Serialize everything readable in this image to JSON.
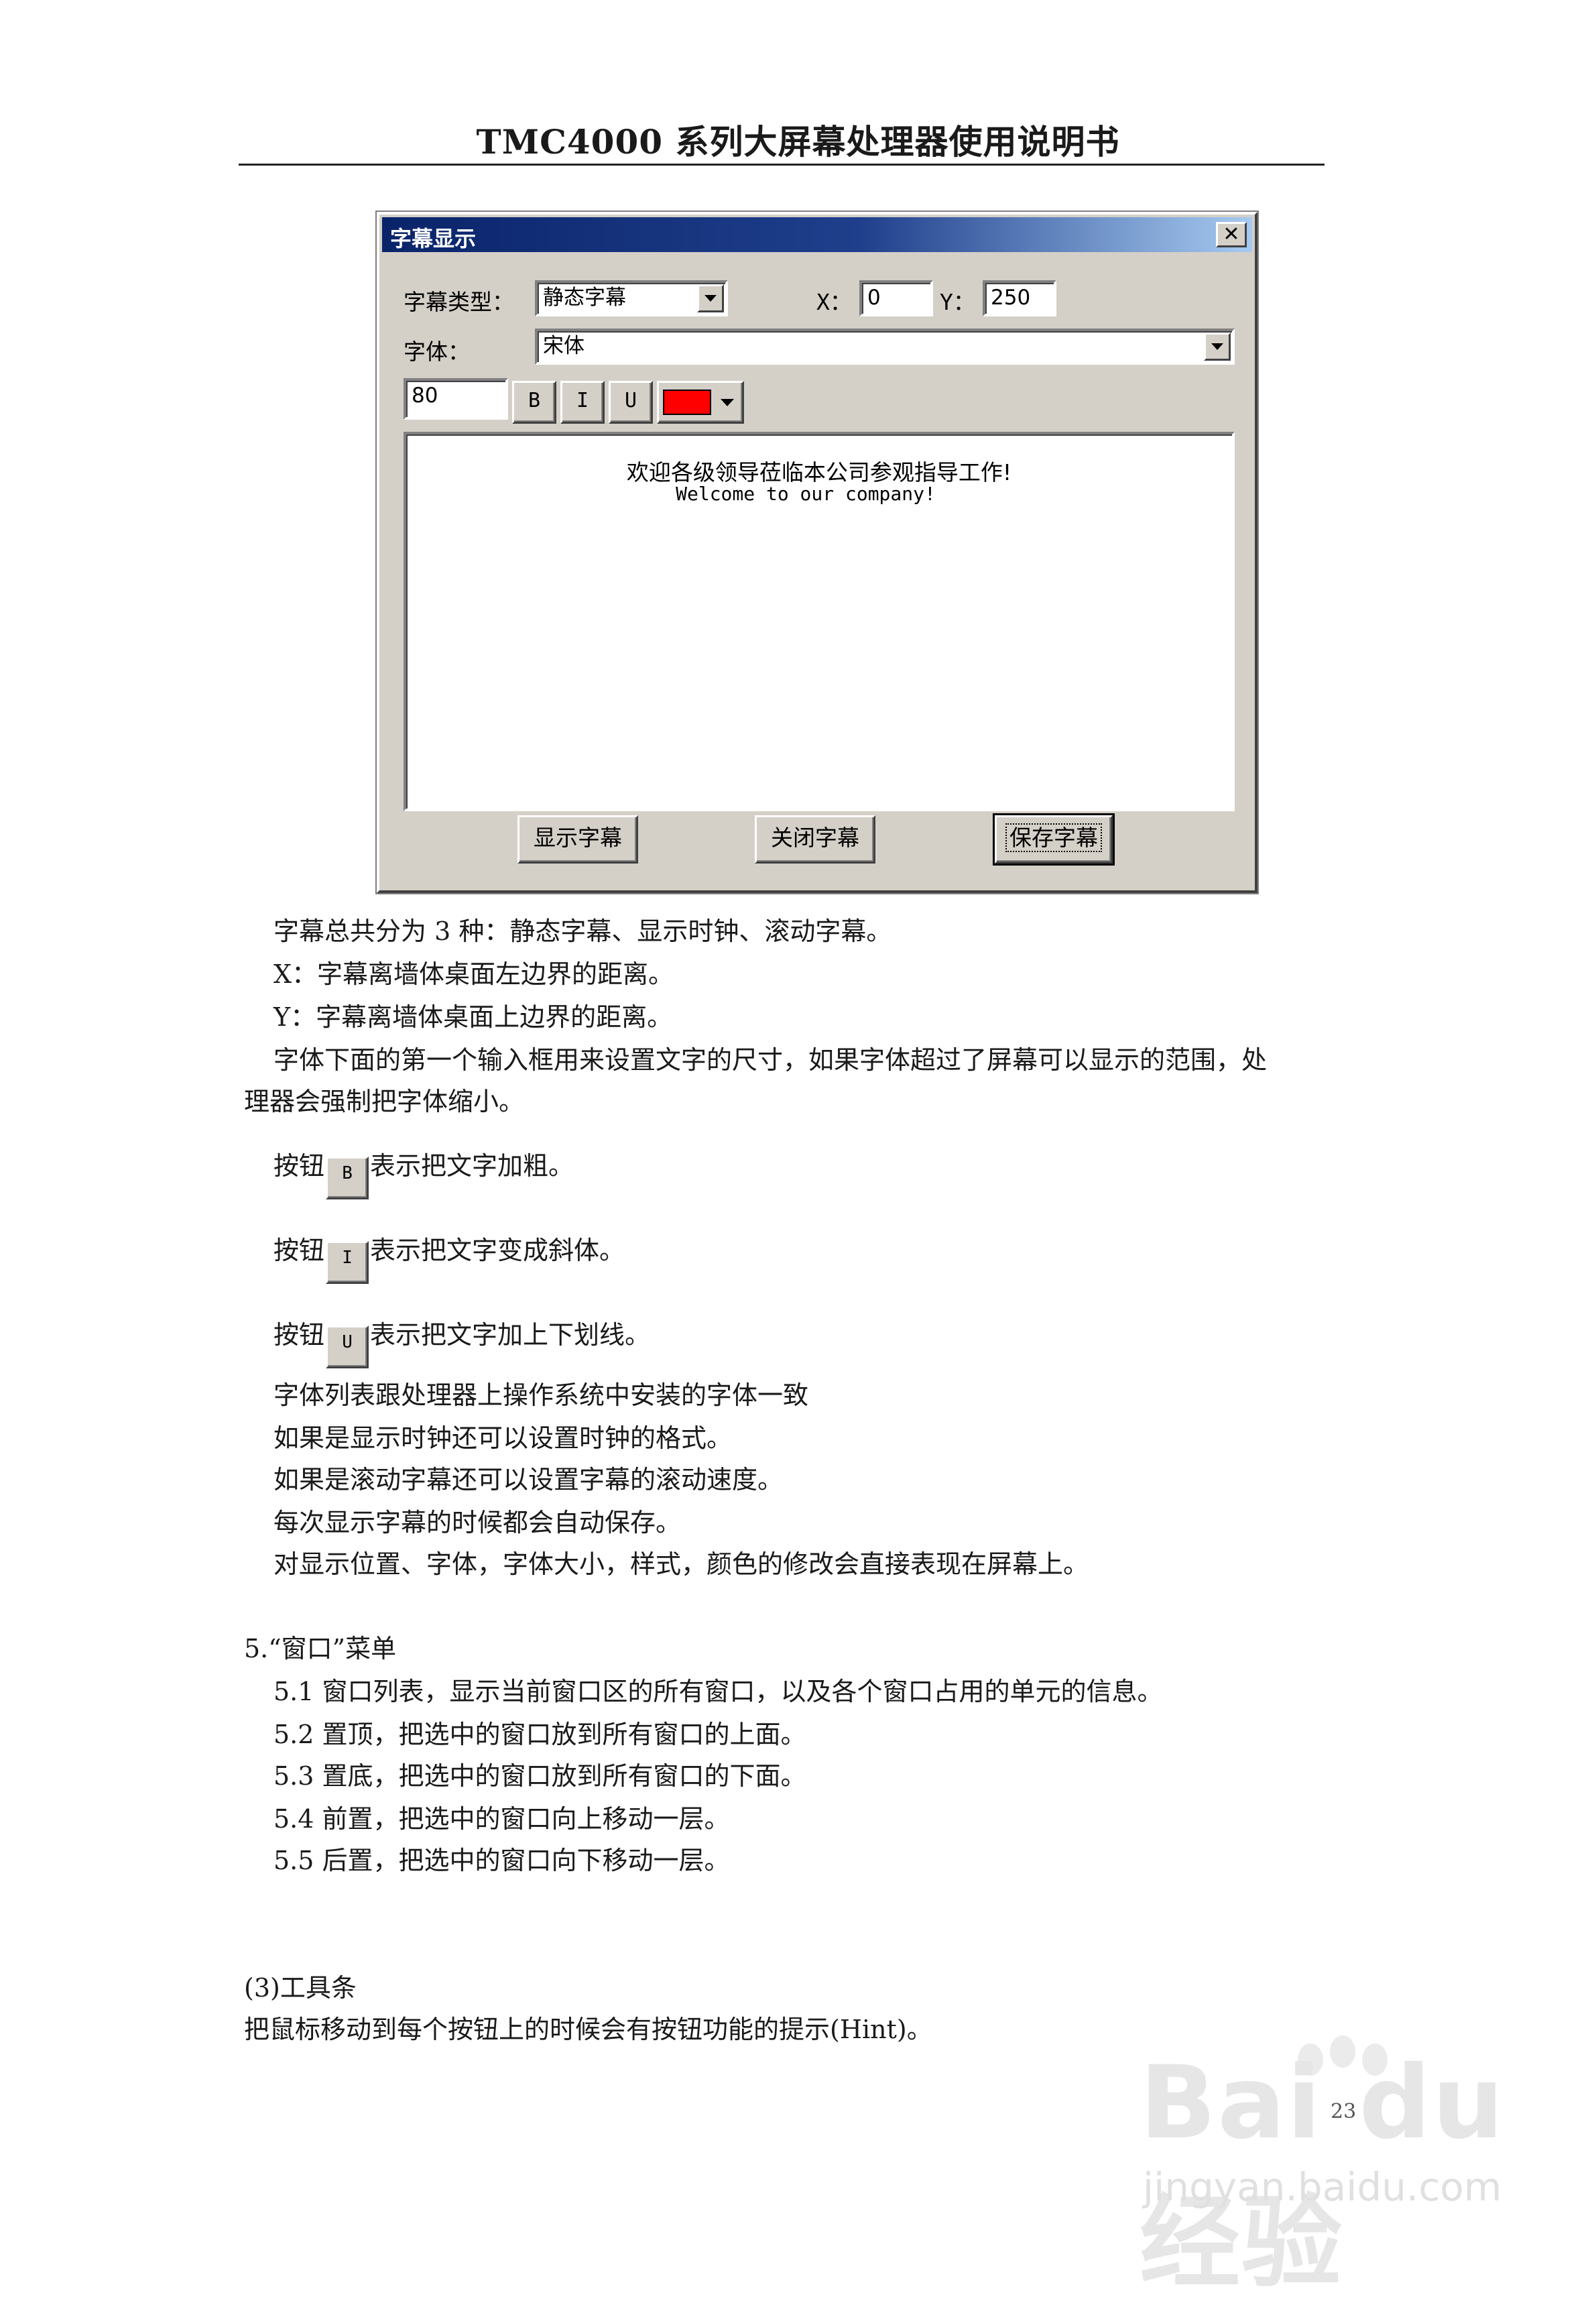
{
  "header": {
    "title": "TMC4000 系列大屏幕处理器使用说明书"
  },
  "dialog": {
    "title": "字幕显示",
    "close_glyph": "✕",
    "type_label": "字幕类型：",
    "type_value": "静态字幕",
    "x_label": "X：",
    "x_value": "0",
    "y_label": "Y：",
    "y_value": "250",
    "font_label": "字体：",
    "font_value": "宋体",
    "size_value": "80",
    "bold_label": "B",
    "italic_label": "I",
    "underline_label": "U",
    "text_color": "#ff0000",
    "preview_line1": "欢迎各级领导莅临本公司参观指导工作!",
    "preview_line2": "Welcome to our company!",
    "show_button": "显示字幕",
    "close_button": "关闭字幕",
    "save_button": "保存字幕"
  },
  "body": {
    "p1": "字幕总共分为 3 种：静态字幕、显示时钟、滚动字幕。",
    "p2": "X：字幕离墙体桌面左边界的距离。",
    "p3": "Y：字幕离墙体桌面上边界的距离。",
    "p4a": "字体下面的第一个输入框用来设置文字的尺寸，如果字体超过了屏幕可以显示的范围，处",
    "p4b": "理器会强制把字体缩小。",
    "btn_prefix": "按钮",
    "bold_desc": "表示把文字加粗。",
    "italic_desc": "表示把文字变成斜体。",
    "underline_desc": "表示把文字加上下划线。",
    "p5": "字体列表跟处理器上操作系统中安装的字体一致",
    "p6": "如果是显示时钟还可以设置时钟的格式。",
    "p7": "如果是滚动字幕还可以设置字幕的滚动速度。",
    "p8": "每次显示字幕的时候都会自动保存。",
    "p9": "对显示位置、字体，字体大小，样式，颜色的修改会直接表现在屏幕上。",
    "s5_title": "5.“窗口”菜单",
    "s5_1": "5.1 窗口列表，显示当前窗口区的所有窗口，以及各个窗口占用的单元的信息。",
    "s5_2": "5.2 置顶，把选中的窗口放到所有窗口的上面。",
    "s5_3": "5.3 置底，把选中的窗口放到所有窗口的下面。",
    "s5_4": "5.4 前置，把选中的窗口向上移动一层。",
    "s5_5": "5.5 后置，把选中的窗口向下移动一层。",
    "s3_title": "(3)工具条",
    "s3_text": "把鼠标移动到每个按钮上的时候会有按钮功能的提示(Hint)。"
  },
  "page_number": "23",
  "watermark": {
    "logo": "Bai du 经验",
    "url": "jingyan.baidu.com"
  }
}
